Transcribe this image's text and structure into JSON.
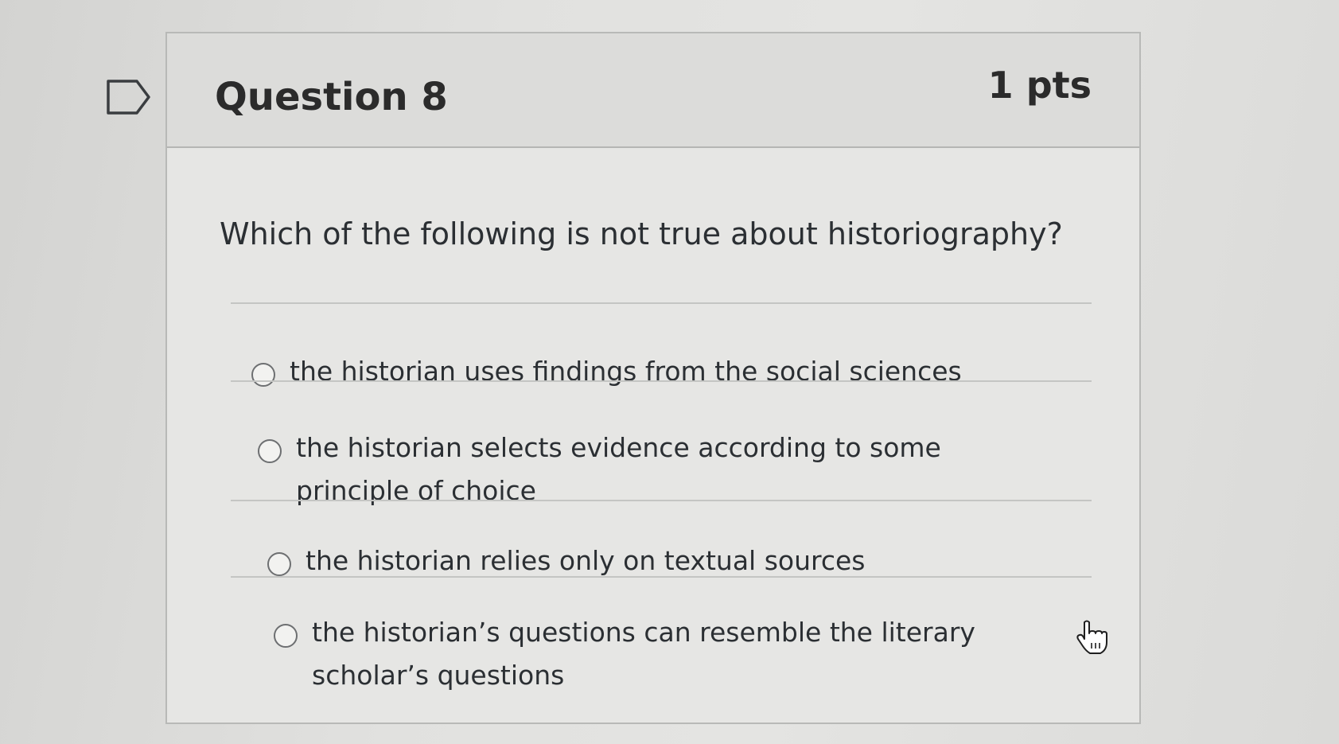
{
  "question": {
    "title": "Question 8",
    "points": "1 pts",
    "text": "Which of the following is not true about historiography?"
  },
  "answers": [
    {
      "label": "the historian uses findings from the social sciences",
      "selected": false
    },
    {
      "label": "the historian selects evidence according to some principle of choice",
      "selected": false
    },
    {
      "label": "the historian relies only on textual sources",
      "selected": false
    },
    {
      "label": "the historian’s questions can resemble the literary scholar’s questions",
      "selected": false
    }
  ],
  "icons": {
    "flag": "flag-question-icon",
    "cursor": "hand-pointer-cursor-icon"
  }
}
